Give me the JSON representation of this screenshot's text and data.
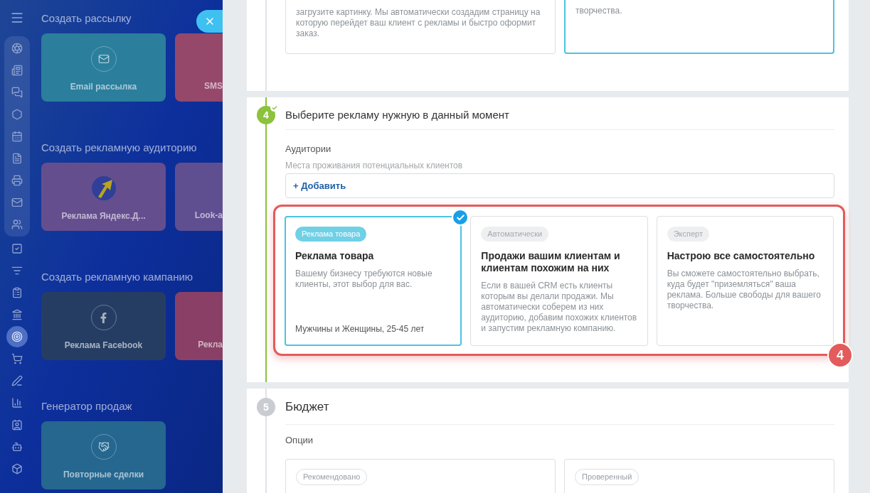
{
  "sidebar": {
    "items": [
      {
        "selected": false
      },
      {
        "selected": false
      },
      {
        "selected": false
      },
      {
        "selected": false
      },
      {
        "selected": false
      },
      {
        "selected": false
      },
      {
        "selected": false
      },
      {
        "selected": false
      },
      {
        "selected": false
      },
      {
        "selected": false
      },
      {
        "selected": false
      },
      {
        "selected": false
      },
      {
        "selected": false
      },
      {
        "selected": true
      },
      {
        "selected": false
      },
      {
        "selected": false
      },
      {
        "selected": false
      },
      {
        "selected": false
      },
      {
        "selected": false
      },
      {
        "selected": false
      }
    ]
  },
  "panel": {
    "sections": [
      {
        "title": "Создать рассылку",
        "tiles": [
          {
            "label": "Email рассылка",
            "kind": "mail",
            "color": "#2b7e9c"
          },
          {
            "label": "SMS",
            "kind": "none",
            "color": "#95486a"
          }
        ]
      },
      {
        "title": "Создать рекламную аудиторию",
        "tiles": [
          {
            "label": "Реклама Яндекс.Д...",
            "kind": "yandex",
            "color": "#654e8e"
          },
          {
            "label": "Look-a",
            "kind": "none",
            "color": "#5f4f90"
          }
        ]
      },
      {
        "title": "Создать рекламную кампанию",
        "tiles": [
          {
            "label": "Реклама Facebook",
            "kind": "facebook",
            "color": "#263d63"
          },
          {
            "label": "Рекла",
            "kind": "none",
            "color": "#8a4066"
          }
        ]
      },
      {
        "title": "Генератор продаж",
        "tiles": [
          {
            "label": "Повторные сделки",
            "kind": "handshake",
            "color": "#25678f"
          }
        ]
      }
    ]
  },
  "step_3": {
    "options": [
      {
        "description": "загрузите картинку. Мы автоматически создадим страницу на которую перейдет ваш клиент с рекламы и быстро оформит заказ.",
        "selected": false
      },
      {
        "description": "творчества.",
        "selected": true
      }
    ]
  },
  "step_4": {
    "number": "4",
    "done": true,
    "title": "Выберите рекламу нужную в данный момент",
    "field_label": "Аудитории",
    "hint": "Места проживания потенциальных клиентов",
    "add_button": "+ Добавить",
    "annotation": "4",
    "options": [
      {
        "badge": "Реклама товара",
        "title": "Реклама товара",
        "description": "Вашему бизнесу требуются новые клиенты, этот выбор для вас.",
        "footer": "Мужчины и Женщины, 25-45 лет",
        "selected": true
      },
      {
        "badge": "Автоматически",
        "title": "Продажи вашим клиентам и клиентам похожим на них",
        "description": "Если в вашей CRM есть клиенты которым вы делали продажи. Мы автоматически соберем из них аудиторию, добавим похожих клиентов и запустим рекламную компанию.",
        "selected": false
      },
      {
        "badge": "Эксперт",
        "title": "Настрою все самостоятельно",
        "description": "Вы сможете самостоятельно выбрать, куда будет \"приземляться\" ваша реклама. Больше свободы для вашего творчества.",
        "selected": false
      }
    ]
  },
  "step_5": {
    "number": "5",
    "done": false,
    "title": "Бюджет",
    "field_label": "Опции",
    "options": [
      {
        "badge": "Рекомендовано",
        "selected": false
      },
      {
        "badge": "Проверенный",
        "selected": false
      }
    ]
  }
}
